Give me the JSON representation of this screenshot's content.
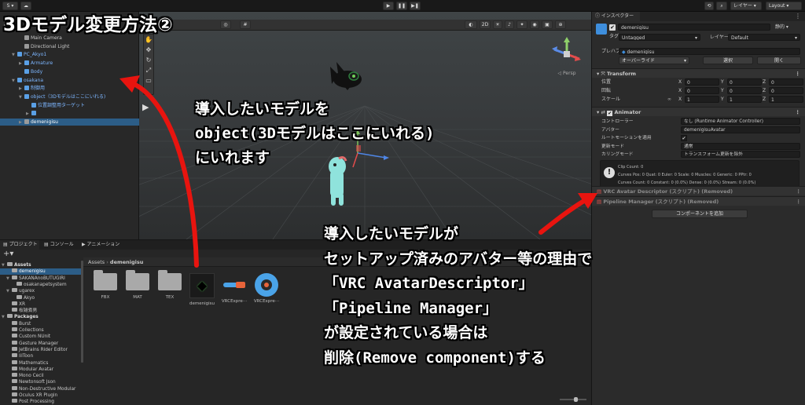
{
  "toolbar": {
    "account_label": "S ▾",
    "cloud_label": "☁",
    "layers_label": "レイヤー",
    "layout_label": "Layout"
  },
  "hierarchy": {
    "items": [
      {
        "label": "Main Camera",
        "indent": 2,
        "color": "#c8c8c8",
        "arrow": ""
      },
      {
        "label": "Directional Light",
        "indent": 2,
        "color": "#c8c8c8",
        "arrow": ""
      },
      {
        "label": "PC_Akyo1",
        "indent": 1,
        "color": "#7db6ff",
        "arrow": "▼"
      },
      {
        "label": "Armature",
        "indent": 2,
        "color": "#7db6ff",
        "arrow": "▶"
      },
      {
        "label": "Body",
        "indent": 2,
        "color": "#7db6ff",
        "arrow": ""
      },
      {
        "label": "osakana",
        "indent": 1,
        "color": "#7db6ff",
        "arrow": "▼"
      },
      {
        "label": "制御用",
        "indent": 2,
        "color": "#7db6ff",
        "arrow": "▶"
      },
      {
        "label": "object（3Dモデルはここにいれる)",
        "indent": 2,
        "color": "#7db6ff",
        "arrow": "▼"
      },
      {
        "label": "位置調整用ターゲット",
        "indent": 3,
        "color": "#7db6ff",
        "arrow": ""
      },
      {
        "label": "",
        "indent": 3,
        "color": "#7db6ff",
        "arrow": "▶"
      },
      {
        "label": "demenigisu",
        "indent": 2,
        "color": "#c8c8c8",
        "arrow": "▶"
      }
    ]
  },
  "scene": {
    "tab_label": "シーン",
    "game_tab_label": "ゲーム",
    "btn_2d": "2D"
  },
  "overlay": {
    "title": "3Dモデル変更方法②",
    "note1": [
      "導入したいモデルを",
      "object(3Dモデルはここにいれる)",
      "にいれます"
    ],
    "note2": [
      "導入したいモデルが",
      "セットアップ済みのアバター等の理由で",
      "「VRC AvatarDescriptor」",
      "「Pipeline Manager」",
      "が設定されている場合は",
      "削除(Remove component)する"
    ]
  },
  "project": {
    "tabs": [
      "プロジェクト",
      "コンソール",
      "アニメーション"
    ],
    "breadcrumb_root": "Assets",
    "breadcrumb_sep": "›",
    "breadcrumb_current": "demenigisu",
    "tree": [
      {
        "label": "Assets",
        "indent": 0,
        "bold": true,
        "arrow": "▼"
      },
      {
        "label": "demenigisu",
        "indent": 1,
        "bold": false,
        "arrow": ""
      },
      {
        "label": "SAKANAnoBUTUGIRI",
        "indent": 1,
        "bold": false,
        "arrow": "▼"
      },
      {
        "label": "osakanapetsystem",
        "indent": 2,
        "bold": false,
        "arrow": ""
      },
      {
        "label": "ugarex",
        "indent": 1,
        "bold": false,
        "arrow": "▼"
      },
      {
        "label": "Akyo",
        "indent": 2,
        "bold": false,
        "arrow": ""
      },
      {
        "label": "XR",
        "indent": 1,
        "bold": false,
        "arrow": ""
      },
      {
        "label": "桜雑煮男",
        "indent": 1,
        "bold": false,
        "arrow": ""
      },
      {
        "label": "Packages",
        "indent": 0,
        "bold": true,
        "arrow": "▼"
      },
      {
        "label": "Burst",
        "indent": 1,
        "bold": false,
        "arrow": ""
      },
      {
        "label": "Collections",
        "indent": 1,
        "bold": false,
        "arrow": ""
      },
      {
        "label": "Custom NUnit",
        "indent": 1,
        "bold": false,
        "arrow": ""
      },
      {
        "label": "Gesture Manager",
        "indent": 1,
        "bold": false,
        "arrow": ""
      },
      {
        "label": "JetBrains Rider Editor",
        "indent": 1,
        "bold": false,
        "arrow": ""
      },
      {
        "label": "lilToon",
        "indent": 1,
        "bold": false,
        "arrow": ""
      },
      {
        "label": "Mathematics",
        "indent": 1,
        "bold": false,
        "arrow": ""
      },
      {
        "label": "Modular Avatar",
        "indent": 1,
        "bold": false,
        "arrow": ""
      },
      {
        "label": "Mono Cecil",
        "indent": 1,
        "bold": false,
        "arrow": ""
      },
      {
        "label": "Newtonsoft Json",
        "indent": 1,
        "bold": false,
        "arrow": ""
      },
      {
        "label": "Non-Destructive Modular",
        "indent": 1,
        "bold": false,
        "arrow": ""
      },
      {
        "label": "Oculus XR Plugin",
        "indent": 1,
        "bold": false,
        "arrow": ""
      },
      {
        "label": "Post Processing",
        "indent": 1,
        "bold": false,
        "arrow": ""
      }
    ],
    "assets": [
      {
        "label": "FBX",
        "kind": "folder"
      },
      {
        "label": "MAT",
        "kind": "folder"
      },
      {
        "label": "TEX",
        "kind": "folder"
      },
      {
        "label": "demenigisu",
        "kind": "model"
      },
      {
        "label": "VRCExpre···",
        "kind": "params"
      },
      {
        "label": "VRCExpre···",
        "kind": "menu"
      }
    ]
  },
  "inspector": {
    "tab_label": "インスペクター",
    "object_name": "demenigisu",
    "static_label": "静的",
    "tag_label": "タグ",
    "tag_value": "Untagged",
    "layer_label": "レイヤー",
    "layer_value": "Default",
    "prefab_label": "プレハブ",
    "prefab_value": "demenigisu",
    "override_label": "オーバーライド",
    "select_label": "選択",
    "open_label": "開く",
    "transform": {
      "title": "Transform",
      "rows": [
        {
          "label": "位置",
          "x": "0",
          "y": "0",
          "z": "0"
        },
        {
          "label": "回転",
          "x": "0",
          "y": "0",
          "z": "0"
        },
        {
          "label": "スケール",
          "x": "1",
          "y": "1",
          "z": "1"
        }
      ],
      "axis_x": "X",
      "axis_y": "Y",
      "axis_z": "Z",
      "link_glyph": "∞"
    },
    "animator": {
      "title": "Animator",
      "rows": [
        {
          "label": "コントローラー",
          "value": "なし (Runtime Animator Controller)"
        },
        {
          "label": "アバター",
          "value": "demenigisuAvatar"
        },
        {
          "label": "ルートモーションを適用",
          "value": "✔"
        },
        {
          "label": "更新モード",
          "value": "通常"
        },
        {
          "label": "カリングモード",
          "value": "トランスフォーム更新を除外"
        }
      ],
      "info_lines": [
        "Clip Count: 0",
        "Curves Pos: 0 Quat: 0 Euler: 0 Scale: 0 Muscles: 0 Generic: 0 PPtr: 0",
        "Curves Count: 0 Constant: 0 (0.0%) Dense: 0 (0.0%) Stream: 0 (0.0%)"
      ]
    },
    "removed_components": [
      "VRC Avatar Descriptor (スクリプト) (Removed)",
      "Pipeline Manager (スクリプト) (Removed)"
    ],
    "add_component_label": "コンポーネントを追加"
  },
  "colors": {
    "accent_blue": "#7db6ff",
    "arrow_red": "#e8140f",
    "selection": "#2c5d87"
  }
}
